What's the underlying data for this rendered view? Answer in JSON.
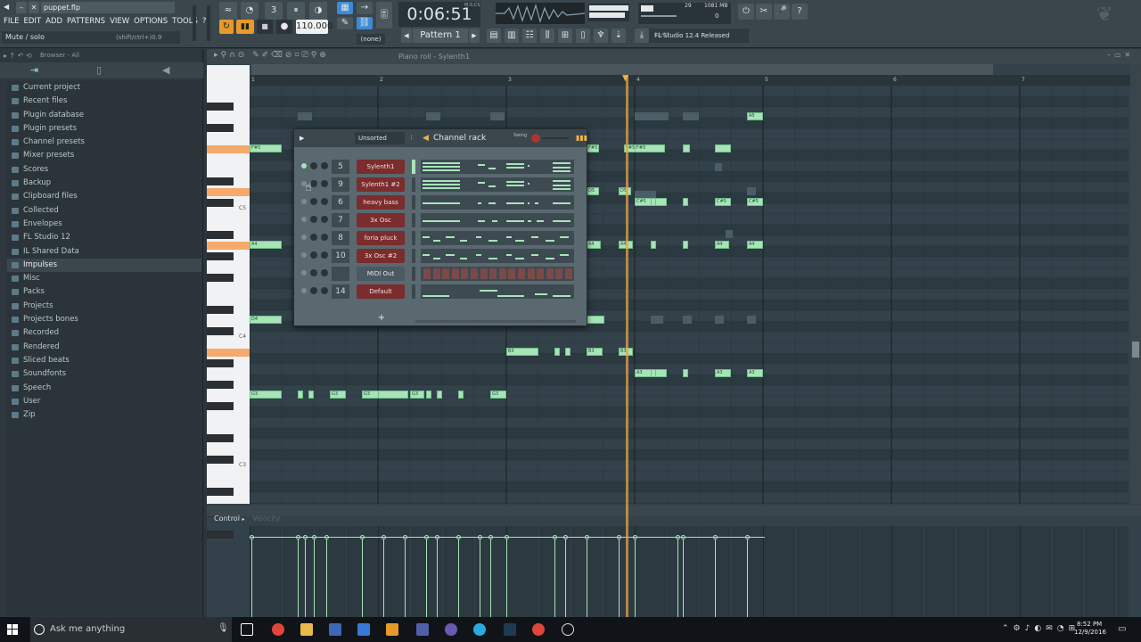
{
  "window": {
    "title": "puppet.flp",
    "hint": "Mute / solo",
    "hint_shortcut": "(shift/ctrl+)0.9"
  },
  "menu": [
    "FILE",
    "EDIT",
    "ADD",
    "PATTERNS",
    "VIEW",
    "OPTIONS",
    "TOOLS",
    "?"
  ],
  "transport": {
    "tempo": "110.000",
    "time": "0:06:51",
    "time_label": "M:S:CS",
    "pattern": "Pattern 1",
    "pattern_mode": "(none)"
  },
  "status": {
    "cpu": "29",
    "memory": "1081 MB",
    "polyphony": "0"
  },
  "news": {
    "id": "11/02",
    "text": "FL Studio 12.4 Released"
  },
  "browser": {
    "header": "Browser - All",
    "items": [
      "Current project",
      "Recent files",
      "Plugin database",
      "Plugin presets",
      "Channel presets",
      "Mixer presets",
      "Scores",
      "Backup",
      "Clipboard files",
      "Collected",
      "Envelopes",
      "FL Studio 12",
      "IL Shared Data",
      "Impulses",
      "Misc",
      "Packs",
      "Projects",
      "Projects bones",
      "Recorded",
      "Rendered",
      "Sliced beats",
      "Soundfonts",
      "Speech",
      "User",
      "Zip"
    ],
    "selected": "Impulses"
  },
  "piano_roll": {
    "title": "Piano roll - Sylenth1",
    "bars": [
      "1",
      "2",
      "3",
      "4",
      "5",
      "6",
      "7"
    ],
    "octaves": [
      "C5",
      "C4",
      "C3"
    ],
    "control_label": "Control",
    "control_param": "Velocity"
  },
  "channel_rack": {
    "title": "Channel rack",
    "filter": "Unsorted",
    "swing_label": "Swing",
    "add": "+",
    "channels": [
      {
        "num": "5",
        "name": "Sylenth1"
      },
      {
        "num": "9",
        "name": "Sylenth1 #2"
      },
      {
        "num": "6",
        "name": "heavy bass"
      },
      {
        "num": "7",
        "name": "3x Osc"
      },
      {
        "num": "8",
        "name": "foria pluck"
      },
      {
        "num": "10",
        "name": "3x Osc #2"
      },
      {
        "num": "",
        "name": "MIDI Out"
      },
      {
        "num": "14",
        "name": "Default"
      }
    ]
  },
  "notes": [
    {
      "label": "F#5"
    },
    {
      "label": "F#5"
    },
    {
      "label": "F#5"
    },
    {
      "label": "F#5"
    },
    {
      "label": "A5"
    },
    {
      "label": "D5"
    },
    {
      "label": "D5"
    },
    {
      "label": "C#5"
    },
    {
      "label": "C#5"
    },
    {
      "label": "C#5"
    },
    {
      "label": "A4"
    },
    {
      "label": "A4"
    },
    {
      "label": "A4"
    },
    {
      "label": "A4"
    },
    {
      "label": "A4"
    },
    {
      "label": "D4"
    },
    {
      "label": "B3"
    },
    {
      "label": "B3"
    },
    {
      "label": "B3"
    },
    {
      "label": "A3"
    },
    {
      "label": "A3"
    },
    {
      "label": "A3"
    },
    {
      "label": "G3"
    },
    {
      "label": "G3"
    },
    {
      "label": "G3"
    },
    {
      "label": "G3"
    },
    {
      "label": "G3"
    }
  ],
  "taskbar": {
    "search": "Ask me anything",
    "time": "8:52 PM",
    "date": "12/9/2016"
  }
}
